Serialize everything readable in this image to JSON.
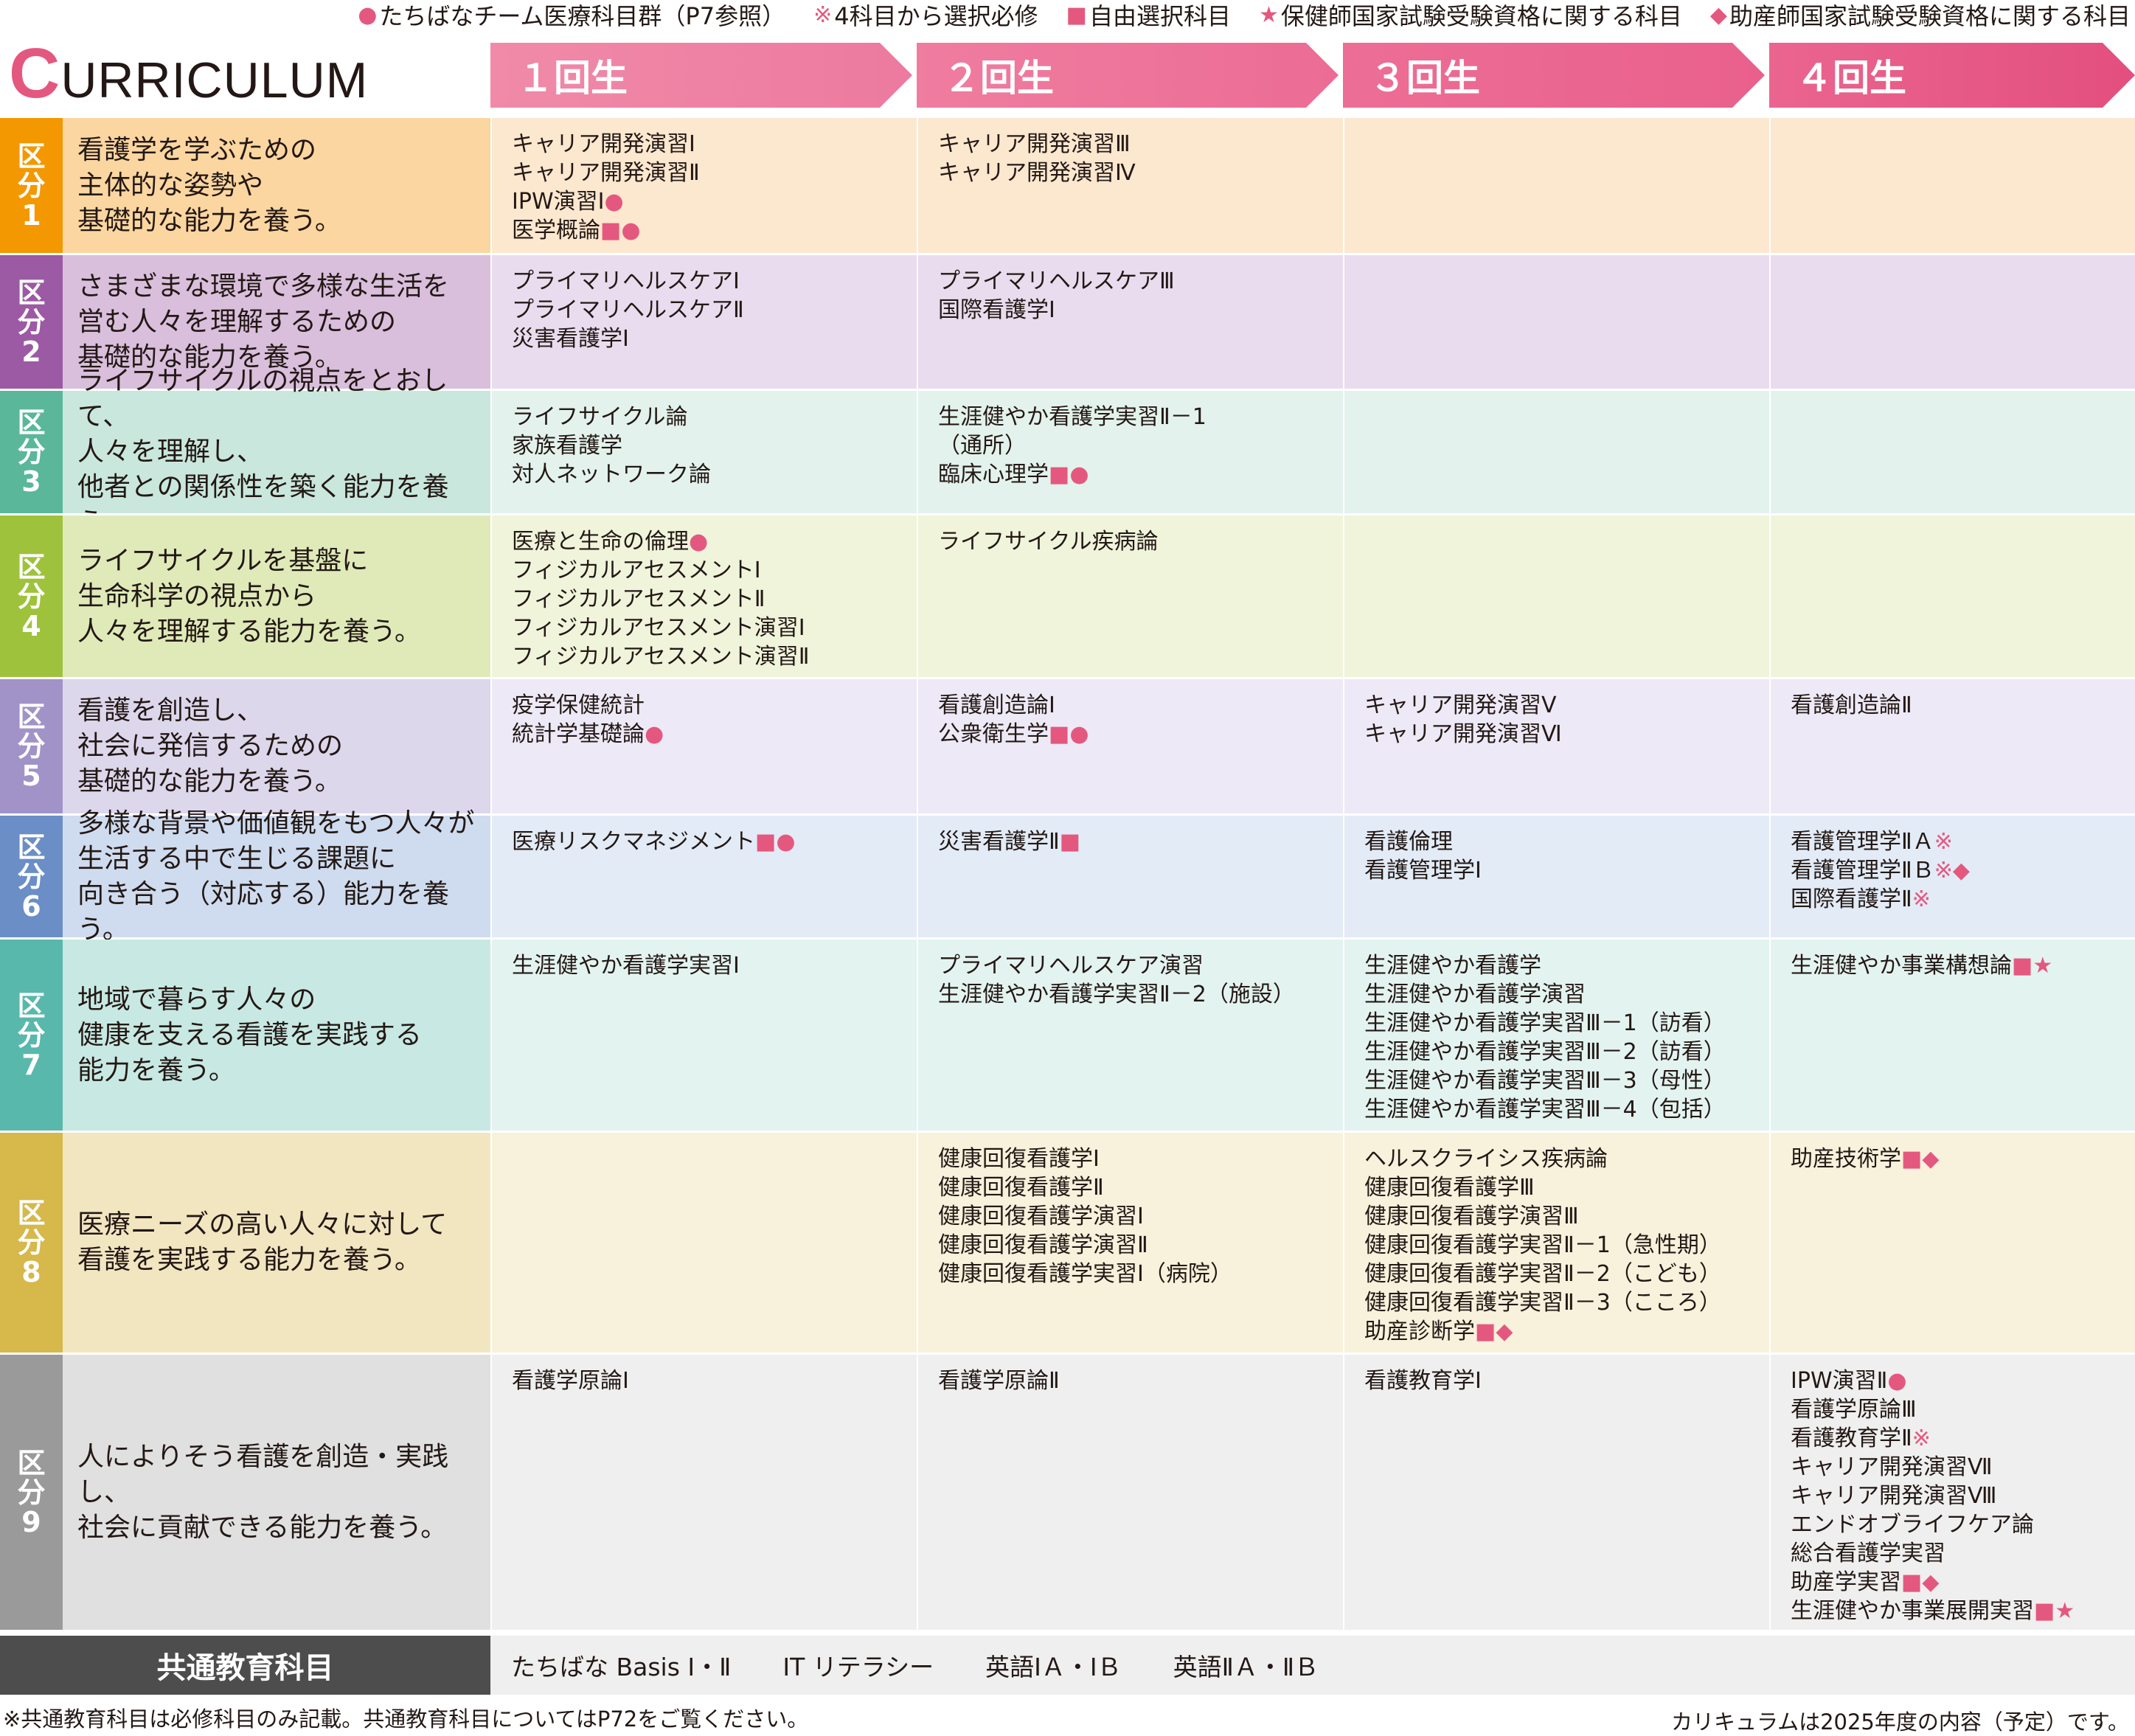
{
  "legend": [
    {
      "marker": "●",
      "text": "たちばなチーム医療科目群（P7参照）"
    },
    {
      "marker": "※",
      "text": "4科目から選択必修"
    },
    {
      "marker": "■",
      "text": "自由選択科目"
    },
    {
      "marker": "★",
      "text": "保健師国家試験受験資格に関する科目"
    },
    {
      "marker": "◆",
      "text": "助産師国家試験受験資格に関する科目"
    }
  ],
  "title": {
    "first_letter": "C",
    "rest": "URRICULUM"
  },
  "years": [
    "１回生",
    "２回生",
    "３回生",
    "４回生"
  ],
  "colors": {
    "accent": "#e4587f"
  },
  "rows": [
    {
      "kubun": [
        "区",
        "分",
        "1"
      ],
      "goal": [
        "看護学を学ぶための",
        "主体的な姿勢や",
        "基礎的な能力を養う。"
      ],
      "cols": [
        [
          "キャリア開発演習Ⅰ",
          "キャリア開発演習Ⅱ",
          "IPW演習Ⅰ●",
          "医学概論■●"
        ],
        [
          "キャリア開発演習Ⅲ",
          "キャリア開発演習Ⅳ"
        ],
        [],
        []
      ]
    },
    {
      "kubun": [
        "区",
        "分",
        "2"
      ],
      "goal": [
        "さまざまな環境で多様な生活を",
        "営む人々を理解するための",
        "基礎的な能力を養う。"
      ],
      "cols": [
        [
          "プライマリヘルスケアⅠ",
          "プライマリヘルスケアⅡ",
          "災害看護学Ⅰ"
        ],
        [
          "プライマリヘルスケアⅢ",
          "国際看護学Ⅰ"
        ],
        [],
        []
      ]
    },
    {
      "kubun": [
        "区",
        "分",
        "3"
      ],
      "goal": [
        "ライフサイクルの視点をとおして、",
        "人々を理解し、",
        "他者との関係性を築く能力を養う。"
      ],
      "cols": [
        [
          "ライフサイクル論",
          "家族看護学",
          "対人ネットワーク論"
        ],
        [
          "生涯健やか看護学実習Ⅱ－1",
          "（通所）",
          "臨床心理学■●"
        ],
        [],
        []
      ]
    },
    {
      "kubun": [
        "区",
        "分",
        "4"
      ],
      "goal": [
        "ライフサイクルを基盤に",
        "生命科学の視点から",
        "人々を理解する能力を養う。"
      ],
      "cols": [
        [
          "医療と生命の倫理●",
          "フィジカルアセスメントⅠ",
          "フィジカルアセスメントⅡ",
          "フィジカルアセスメント演習Ⅰ",
          "フィジカルアセスメント演習Ⅱ"
        ],
        [
          "ライフサイクル疾病論"
        ],
        [],
        []
      ]
    },
    {
      "kubun": [
        "区",
        "分",
        "5"
      ],
      "goal": [
        "看護を創造し、",
        "社会に発信するための",
        "基礎的な能力を養う。"
      ],
      "cols": [
        [
          "疫学保健統計",
          "統計学基礎論●"
        ],
        [
          "看護創造論Ⅰ",
          "公衆衛生学■●"
        ],
        [
          "キャリア開発演習Ⅴ",
          "キャリア開発演習Ⅵ"
        ],
        [
          "看護創造論Ⅱ"
        ]
      ]
    },
    {
      "kubun": [
        "区",
        "分",
        "6"
      ],
      "goal": [
        "多様な背景や価値観をもつ人々が",
        "生活する中で生じる課題に",
        "向き合う（対応する）能力を養う。"
      ],
      "cols": [
        [
          "医療リスクマネジメント■●"
        ],
        [
          "災害看護学Ⅱ■"
        ],
        [
          "看護倫理",
          "看護管理学Ⅰ"
        ],
        [
          "看護管理学ⅡＡ※",
          "看護管理学ⅡＢ※◆",
          "国際看護学Ⅱ※"
        ]
      ]
    },
    {
      "kubun": [
        "区",
        "分",
        "7"
      ],
      "goal": [
        "地域で暮らす人々の",
        "健康を支える看護を実践する",
        "能力を養う。"
      ],
      "cols": [
        [
          "生涯健やか看護学実習Ⅰ"
        ],
        [
          "プライマリヘルスケア演習",
          "生涯健やか看護学実習Ⅱ－2（施設）"
        ],
        [
          "生涯健やか看護学",
          "生涯健やか看護学演習",
          "生涯健やか看護学実習Ⅲ－1（訪看）",
          "生涯健やか看護学実習Ⅲ－2（訪看）",
          "生涯健やか看護学実習Ⅲ－3（母性）",
          "生涯健やか看護学実習Ⅲ－4（包括）"
        ],
        [
          "生涯健やか事業構想論■★"
        ]
      ]
    },
    {
      "kubun": [
        "区",
        "分",
        "8"
      ],
      "goal": [
        "医療ニーズの高い人々に対して",
        "看護を実践する能力を養う。"
      ],
      "cols": [
        [],
        [
          "健康回復看護学Ⅰ",
          "健康回復看護学Ⅱ",
          "健康回復看護学演習Ⅰ",
          "健康回復看護学演習Ⅱ",
          "健康回復看護学実習Ⅰ（病院）"
        ],
        [
          "ヘルスクライシス疾病論",
          "健康回復看護学Ⅲ",
          "健康回復看護学演習Ⅲ",
          "健康回復看護学実習Ⅱ－1（急性期）",
          "健康回復看護学実習Ⅱ－2（こども）",
          "健康回復看護学実習Ⅱ－3（こころ）",
          "助産診断学■◆"
        ],
        [
          "助産技術学■◆"
        ]
      ]
    },
    {
      "kubun": [
        "区",
        "分",
        "9"
      ],
      "goal": [
        "人によりそう看護を創造・実践し、",
        "社会に貢献できる能力を養う。"
      ],
      "cols": [
        [
          "看護学原論Ⅰ"
        ],
        [
          "看護学原論Ⅱ"
        ],
        [
          "看護教育学Ⅰ"
        ],
        [
          "IPW演習Ⅱ●",
          "看護学原論Ⅲ",
          "看護教育学Ⅱ※",
          "キャリア開発演習Ⅶ",
          "キャリア開発演習Ⅷ",
          "エンドオブライフケア論",
          "総合看護学実習",
          "助産学実習■◆",
          "生涯健やか事業展開実習■★"
        ]
      ]
    }
  ],
  "common": {
    "label": "共通教育科目",
    "items": [
      "たちばな Basis Ⅰ・Ⅱ",
      "IT リテラシー",
      "英語ⅠＡ・ⅠＢ",
      "英語ⅡＡ・ⅡＢ"
    ]
  },
  "footer": {
    "left": "※共通教育科目は必修科目のみ記載。共通教育科目についてはP72をご覧ください。",
    "right": "カリキュラムは2025年度の内容（予定）です。"
  }
}
